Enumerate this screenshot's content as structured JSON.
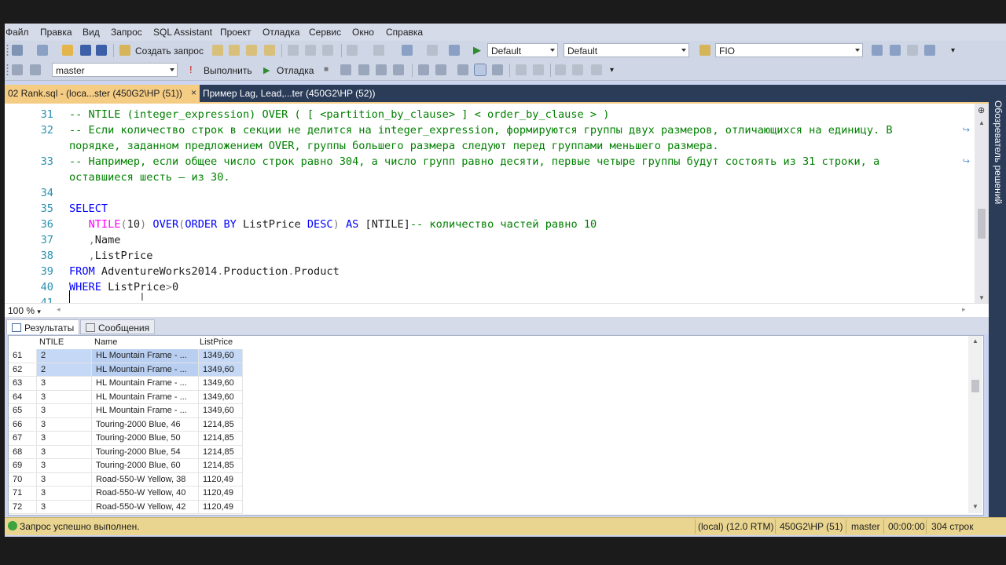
{
  "menu": [
    "Файл",
    "Правка",
    "Вид",
    "Запрос",
    "SQL Assistant",
    "Проект",
    "Отладка",
    "Сервис",
    "Окно",
    "Справка"
  ],
  "toolbar1": {
    "new_query_label": "Создать запрос",
    "solution_config": "Default",
    "solution_platform": "Default",
    "find_box": "FIO"
  },
  "toolbar2": {
    "database": "master",
    "execute_label": "Выполнить",
    "debug_label": "Отладка"
  },
  "tabs": [
    {
      "label": "02 Rank.sql - (loca...ster (450G2\\HP (51))",
      "active": true,
      "close": "×"
    },
    {
      "label": "Пример Lag, Lead,...ter (450G2\\HP (52))",
      "active": false
    }
  ],
  "side_panel_label": "Обозреватель решений",
  "editor": {
    "lines": [
      {
        "n": "31",
        "tokens": [
          [
            "c",
            "-- NTILE (integer_expression) OVER ( [ <partition_by_clause> ] < order_by_clause > )"
          ]
        ]
      },
      {
        "n": "32",
        "wrap": true,
        "tokens": [
          [
            "c",
            "-- Если количество строк в секции не делится на integer_expression, формируются группы двух размеров, отличающихся на единицу. В"
          ]
        ]
      },
      {
        "n": "",
        "tokens": [
          [
            "c",
            "порядке, заданном предложением OVER, группы большего размера следуют перед группами меньшего размера."
          ]
        ]
      },
      {
        "n": "33",
        "wrap": true,
        "tokens": [
          [
            "c",
            "-- Например, если общее число строк равно 304, а число групп равно десяти, первые четыре группы будут состоять из 31 строки, а"
          ]
        ]
      },
      {
        "n": "",
        "tokens": [
          [
            "c",
            "оставшиеся шесть — из 30."
          ]
        ]
      },
      {
        "n": "34",
        "tokens": []
      },
      {
        "n": "35",
        "tokens": [
          [
            "k",
            "SELECT"
          ]
        ]
      },
      {
        "n": "36",
        "tokens": [
          [
            "i",
            "   "
          ],
          [
            "f",
            "NTILE"
          ],
          [
            "o",
            "("
          ],
          [
            "i",
            "10"
          ],
          [
            "o",
            ")"
          ],
          [
            "i",
            " "
          ],
          [
            "k",
            "OVER"
          ],
          [
            "o",
            "("
          ],
          [
            "k",
            "ORDER BY"
          ],
          [
            "i",
            " ListPrice "
          ],
          [
            "k",
            "DESC"
          ],
          [
            "o",
            ")"
          ],
          [
            "i",
            " "
          ],
          [
            "k",
            "AS"
          ],
          [
            "i",
            " [NTILE]"
          ],
          [
            "c",
            "-- количество частей равно 10"
          ]
        ]
      },
      {
        "n": "37",
        "tokens": [
          [
            "i",
            "   "
          ],
          [
            "o",
            ","
          ],
          [
            "i",
            "Name"
          ]
        ]
      },
      {
        "n": "38",
        "tokens": [
          [
            "i",
            "   "
          ],
          [
            "o",
            ","
          ],
          [
            "i",
            "ListPrice"
          ]
        ]
      },
      {
        "n": "39",
        "tokens": [
          [
            "k",
            "FROM"
          ],
          [
            "i",
            " AdventureWorks2014"
          ],
          [
            "o",
            "."
          ],
          [
            "i",
            "Production"
          ],
          [
            "o",
            "."
          ],
          [
            "i",
            "Product"
          ]
        ]
      },
      {
        "n": "40",
        "tokens": [
          [
            "k",
            "WHERE"
          ],
          [
            "i",
            " ListPrice"
          ],
          [
            "o",
            ">"
          ],
          [
            "i",
            "0"
          ]
        ]
      },
      {
        "n": "41",
        "tokens": []
      }
    ]
  },
  "zoom": "100 %",
  "results_tabs": {
    "results": "Результаты",
    "messages": "Сообщения"
  },
  "grid": {
    "columns": [
      "NTILE",
      "Name",
      "ListPrice"
    ],
    "rows": [
      {
        "n": "61",
        "ntile": "2",
        "name": "HL Mountain Frame - ...",
        "price": "1349,60",
        "selected": true
      },
      {
        "n": "62",
        "ntile": "2",
        "name": "HL Mountain Frame - ...",
        "price": "1349,60",
        "selected": true
      },
      {
        "n": "63",
        "ntile": "3",
        "name": "HL Mountain Frame - ...",
        "price": "1349,60"
      },
      {
        "n": "64",
        "ntile": "3",
        "name": "HL Mountain Frame - ...",
        "price": "1349,60"
      },
      {
        "n": "65",
        "ntile": "3",
        "name": "HL Mountain Frame - ...",
        "price": "1349,60"
      },
      {
        "n": "66",
        "ntile": "3",
        "name": "Touring-2000 Blue, 46",
        "price": "1214,85"
      },
      {
        "n": "67",
        "ntile": "3",
        "name": "Touring-2000 Blue, 50",
        "price": "1214,85"
      },
      {
        "n": "68",
        "ntile": "3",
        "name": "Touring-2000 Blue, 54",
        "price": "1214,85"
      },
      {
        "n": "69",
        "ntile": "3",
        "name": "Touring-2000 Blue, 60",
        "price": "1214,85"
      },
      {
        "n": "70",
        "ntile": "3",
        "name": "Road-550-W Yellow, 38",
        "price": "1120,49"
      },
      {
        "n": "71",
        "ntile": "3",
        "name": "Road-550-W Yellow, 40",
        "price": "1120,49"
      },
      {
        "n": "72",
        "ntile": "3",
        "name": "Road-550-W Yellow, 42",
        "price": "1120,49"
      }
    ]
  },
  "status": {
    "message": "Запрос успешно выполнен.",
    "server": "(local) (12.0 RTM)",
    "user": "450G2\\HP (51)",
    "database": "master",
    "time": "00:00:00",
    "rows": "304 строк"
  },
  "colors": {
    "comment": "#008000",
    "keyword": "#0000ff",
    "function": "#ff00ff",
    "operator": "#808080",
    "line_number": "#2b91af",
    "active_tab": "#f5cc84",
    "tab_strip": "#2b3c59",
    "status_bar": "#e9d58f"
  }
}
